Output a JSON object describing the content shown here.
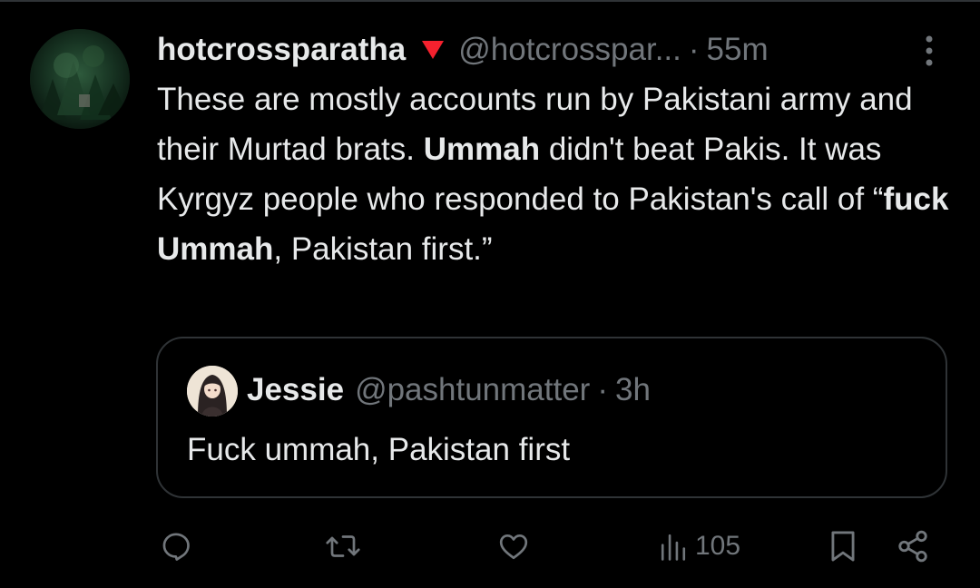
{
  "tweet": {
    "author": {
      "display_name": "hotcrossparatha",
      "handle": "@hotcrosspar...",
      "badge_icon": "red-triangle-icon"
    },
    "separator": "·",
    "time": "55m",
    "text_parts": {
      "p1": "These are mostly accounts run by Pakistani army and their Murtad brats. ",
      "b1": "Ummah",
      "p2": " didn't beat Pakis. It was Kyrgyz people who responded to Pakistan's call of “",
      "b2": "fuck Ummah",
      "p3": ", Pakistan first.”"
    }
  },
  "quoted_tweet": {
    "display_name": "Jessie",
    "handle": "@pashtunmatter",
    "separator": "·",
    "time": "3h",
    "text": "Fuck ummah, Pakistan first"
  },
  "actions": {
    "reply_icon": "reply-icon",
    "retweet_icon": "retweet-icon",
    "like_icon": "heart-icon",
    "views_icon": "views-chart-icon",
    "views_count": "105",
    "bookmark_icon": "bookmark-icon",
    "share_icon": "share-icon"
  },
  "colors": {
    "background": "#000000",
    "text_primary": "#e7e9ea",
    "text_secondary": "#71767b",
    "border": "#2f3336",
    "badge": "#f4212e"
  }
}
